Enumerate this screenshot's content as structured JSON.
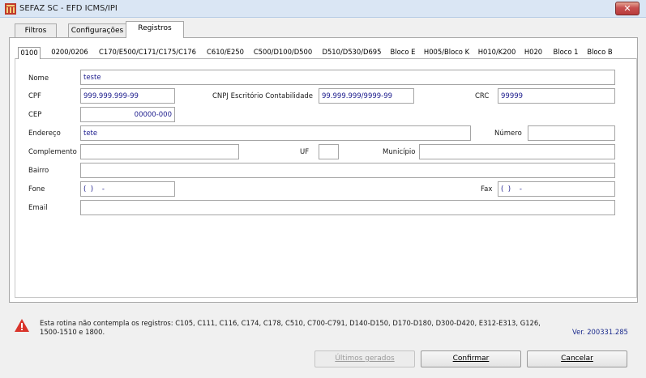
{
  "window": {
    "title": "SEFAZ SC - EFD ICMS/IPI",
    "close_glyph": "✕"
  },
  "top_tabs": [
    {
      "label": "Filtros",
      "active": false
    },
    {
      "label": "Configurações",
      "active": false
    },
    {
      "label": "Registros",
      "active": true
    }
  ],
  "record_tabs": [
    {
      "label": "0100",
      "active": true
    },
    {
      "label": "0200/0206"
    },
    {
      "label": "C170/E500/C171/C175/C176"
    },
    {
      "label": "C610/E250"
    },
    {
      "label": "C500/D100/D500"
    },
    {
      "label": "D510/D530/D695"
    },
    {
      "label": "Bloco E"
    },
    {
      "label": "H005/Bloco K"
    },
    {
      "label": "H010/K200"
    },
    {
      "label": "H020"
    },
    {
      "label": "Bloco 1"
    },
    {
      "label": "Bloco B"
    }
  ],
  "form": {
    "nome": {
      "label": "Nome",
      "value": "teste"
    },
    "cpf": {
      "label": "CPF",
      "value": "999.999.999-99"
    },
    "cnpj": {
      "label": "CNPJ Escritório Contabilidade",
      "value": "99.999.999/9999-99"
    },
    "crc": {
      "label": "CRC",
      "value": "99999"
    },
    "cep": {
      "label": "CEP",
      "value": "00000-000"
    },
    "endereco": {
      "label": "Endereço",
      "value": "tete"
    },
    "numero": {
      "label": "Número",
      "value": ""
    },
    "complemento": {
      "label": "Complemento",
      "value": ""
    },
    "uf": {
      "label": "UF",
      "value": ""
    },
    "municipio": {
      "label": "Município",
      "value": ""
    },
    "bairro": {
      "label": "Bairro",
      "value": ""
    },
    "fone": {
      "label": "Fone",
      "value": "(  )    -"
    },
    "fax": {
      "label": "Fax",
      "value": "(  )    -"
    },
    "email": {
      "label": "Email",
      "value": ""
    }
  },
  "notice": "Esta rotina não contempla os registros: C105, C111, C116, C174, C178, C510, C700-C791, D140-D150, D170-D180, D300-D420, E312-E313, G126, 1500-1510 e 1800.",
  "version": "Ver. 200331.285",
  "buttons": {
    "ultimos_gerados": "Últimos gerados",
    "confirmar": "Confirmar",
    "cancelar": "Cancelar"
  },
  "colors": {
    "title_bar": "#dae6f4",
    "close_button": "#c75050",
    "input_text": "#1a1a8c",
    "warning": "#d9342b"
  },
  "icons": {
    "app": "sefaz-logo-icon",
    "warning": "warning-triangle-icon"
  }
}
